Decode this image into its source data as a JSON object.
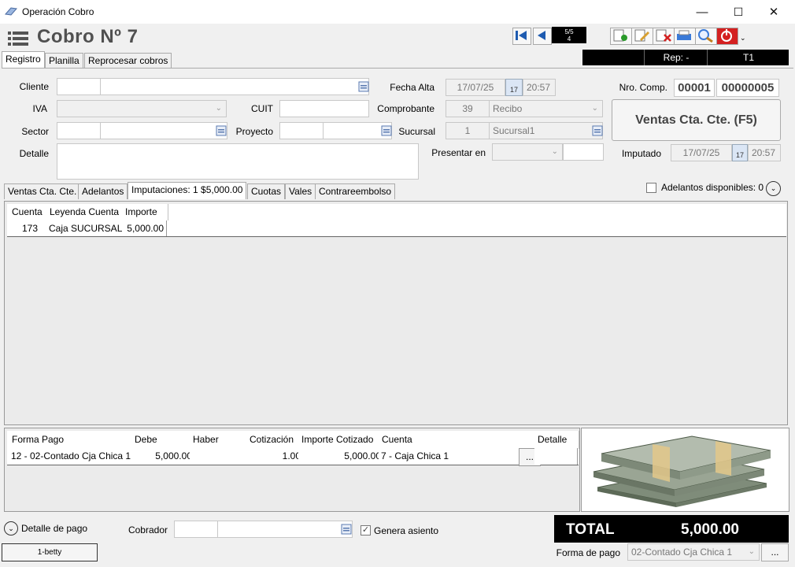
{
  "window": {
    "title": "Operación Cobro",
    "minimize": "—",
    "maximize": "☐",
    "close": "✕"
  },
  "heading": "Cobro Nº  7",
  "pager": {
    "top": "5/5",
    "bottom": "4"
  },
  "status_bar": {
    "rep": "Rep: -",
    "terminal": "T1"
  },
  "tabs": [
    {
      "label": "Registro"
    },
    {
      "label": "Planilla"
    },
    {
      "label": "Reprocesar cobros"
    }
  ],
  "form": {
    "cliente_label": "Cliente",
    "iva_label": "IVA",
    "sector_label": "Sector",
    "detalle_label": "Detalle",
    "cuit_label": "CUIT",
    "proyecto_label": "Proyecto",
    "fecha_alta_label": "Fecha Alta",
    "fecha_alta": "17/07/25",
    "fecha_alta_hora": "20:57",
    "comprobante_label": "Comprobante",
    "comprobante_code": "39",
    "comprobante_value": "Recibo",
    "sucursal_label": "Sucursal",
    "sucursal_code": "1",
    "sucursal_value": "Sucursal1",
    "presentar_label": "Presentar en",
    "nro_comp_label": "Nro. Comp.",
    "nro_comp_a": "00001",
    "nro_comp_b": "00000005",
    "big_button": "Ventas Cta. Cte. (F5)",
    "imputado_label": "Imputado",
    "imputado_fecha": "17/07/25",
    "imputado_hora": "20:57",
    "cal_day": "17"
  },
  "subtabs": [
    {
      "label": "Ventas Cta. Cte."
    },
    {
      "label": "Adelantos"
    },
    {
      "label": "Imputaciones: 1 $5,000.00"
    },
    {
      "label": "Cuotas"
    },
    {
      "label": "Vales"
    },
    {
      "label": "Contrareembolso"
    }
  ],
  "adelantos_disponibles": "Adelantos disponibles: 0",
  "imputaciones": {
    "headers": [
      "Cuenta",
      "Leyenda Cuenta",
      "Importe"
    ],
    "row": [
      "173",
      "Caja SUCURSAL",
      "5,000.00"
    ]
  },
  "pagos": {
    "headers": [
      "Forma Pago",
      "Debe",
      "Haber",
      "Cotización",
      "Importe Cotizado",
      "Cuenta",
      "",
      "Detalle"
    ],
    "row": [
      "12 - 02-Contado Cja Chica 1",
      "5,000.00",
      "",
      "1.00",
      "5,000.00",
      "7 - Caja Chica 1",
      "...",
      ""
    ]
  },
  "total": {
    "label": "TOTAL",
    "value": "5,000.00"
  },
  "footer": {
    "detalle_pago": "Detalle de pago",
    "cobrador_label": "Cobrador",
    "genera_asiento": "Genera asiento",
    "user": "1-betty",
    "forma_pago_label": "Forma de pago",
    "forma_pago_value": "02-Contado Cja Chica 1",
    "ellipsis": "..."
  },
  "colors": {
    "accent": "#1e5bb0",
    "danger": "#d42020",
    "black": "#000000"
  }
}
